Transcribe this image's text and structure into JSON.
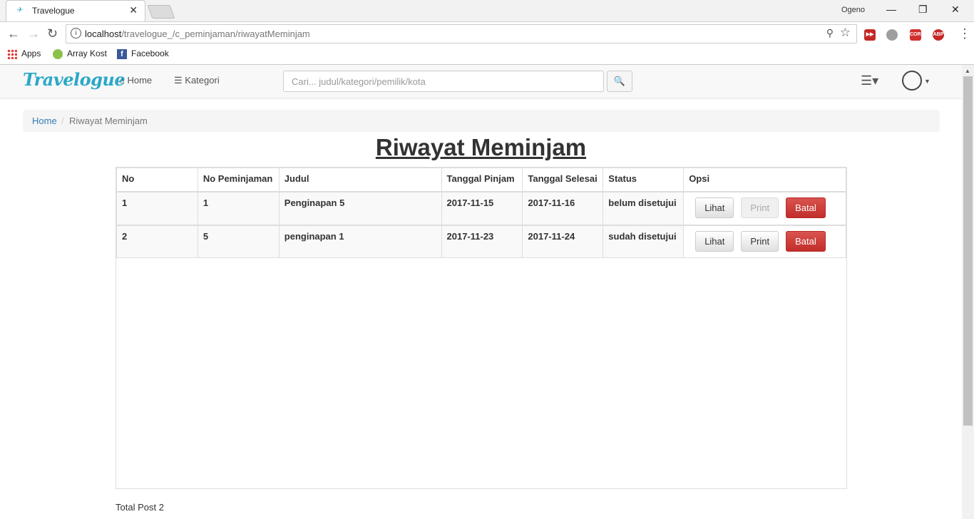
{
  "browser": {
    "tab_title": "Travelogue",
    "profile_name": "Ogeno",
    "url_host": "localhost",
    "url_path": "/travelogue_/c_peminjaman/riwayatMeminjam",
    "bookmarks": [
      "Apps",
      "Array Kost",
      "Facebook"
    ],
    "extensions": [
      "CORS",
      "ABP"
    ]
  },
  "navbar": {
    "logo": "Travelogue",
    "home_label": "Home",
    "kategori_label": "Kategori",
    "search_placeholder": "Cari... judul/kategori/pemilik/kota"
  },
  "breadcrumb": {
    "home": "Home",
    "separator": "/",
    "current": "Riwayat Meminjam"
  },
  "page_title": "Riwayat Meminjam",
  "table": {
    "headers": [
      "No",
      "No Peminjaman",
      "Judul",
      "Tanggal Pinjam",
      "Tanggal Selesai",
      "Status",
      "Opsi"
    ],
    "rows": [
      {
        "no": "1",
        "no_peminjaman": "1",
        "judul": "Penginapan 5",
        "tanggal_pinjam": "2017-11-15",
        "tanggal_selesai": "2017-11-16",
        "status": "belum disetujui",
        "print_enabled": false
      },
      {
        "no": "2",
        "no_peminjaman": "5",
        "judul": "penginapan 1",
        "tanggal_pinjam": "2017-11-23",
        "tanggal_selesai": "2017-11-24",
        "status": "sudah disetujui",
        "print_enabled": true
      }
    ],
    "buttons": {
      "lihat": "Lihat",
      "print": "Print",
      "batal": "Batal"
    }
  },
  "total_text": "Total Post 2",
  "colors": {
    "accent": "#2aa8c8",
    "link": "#337ab7",
    "danger": "#d9534f"
  }
}
